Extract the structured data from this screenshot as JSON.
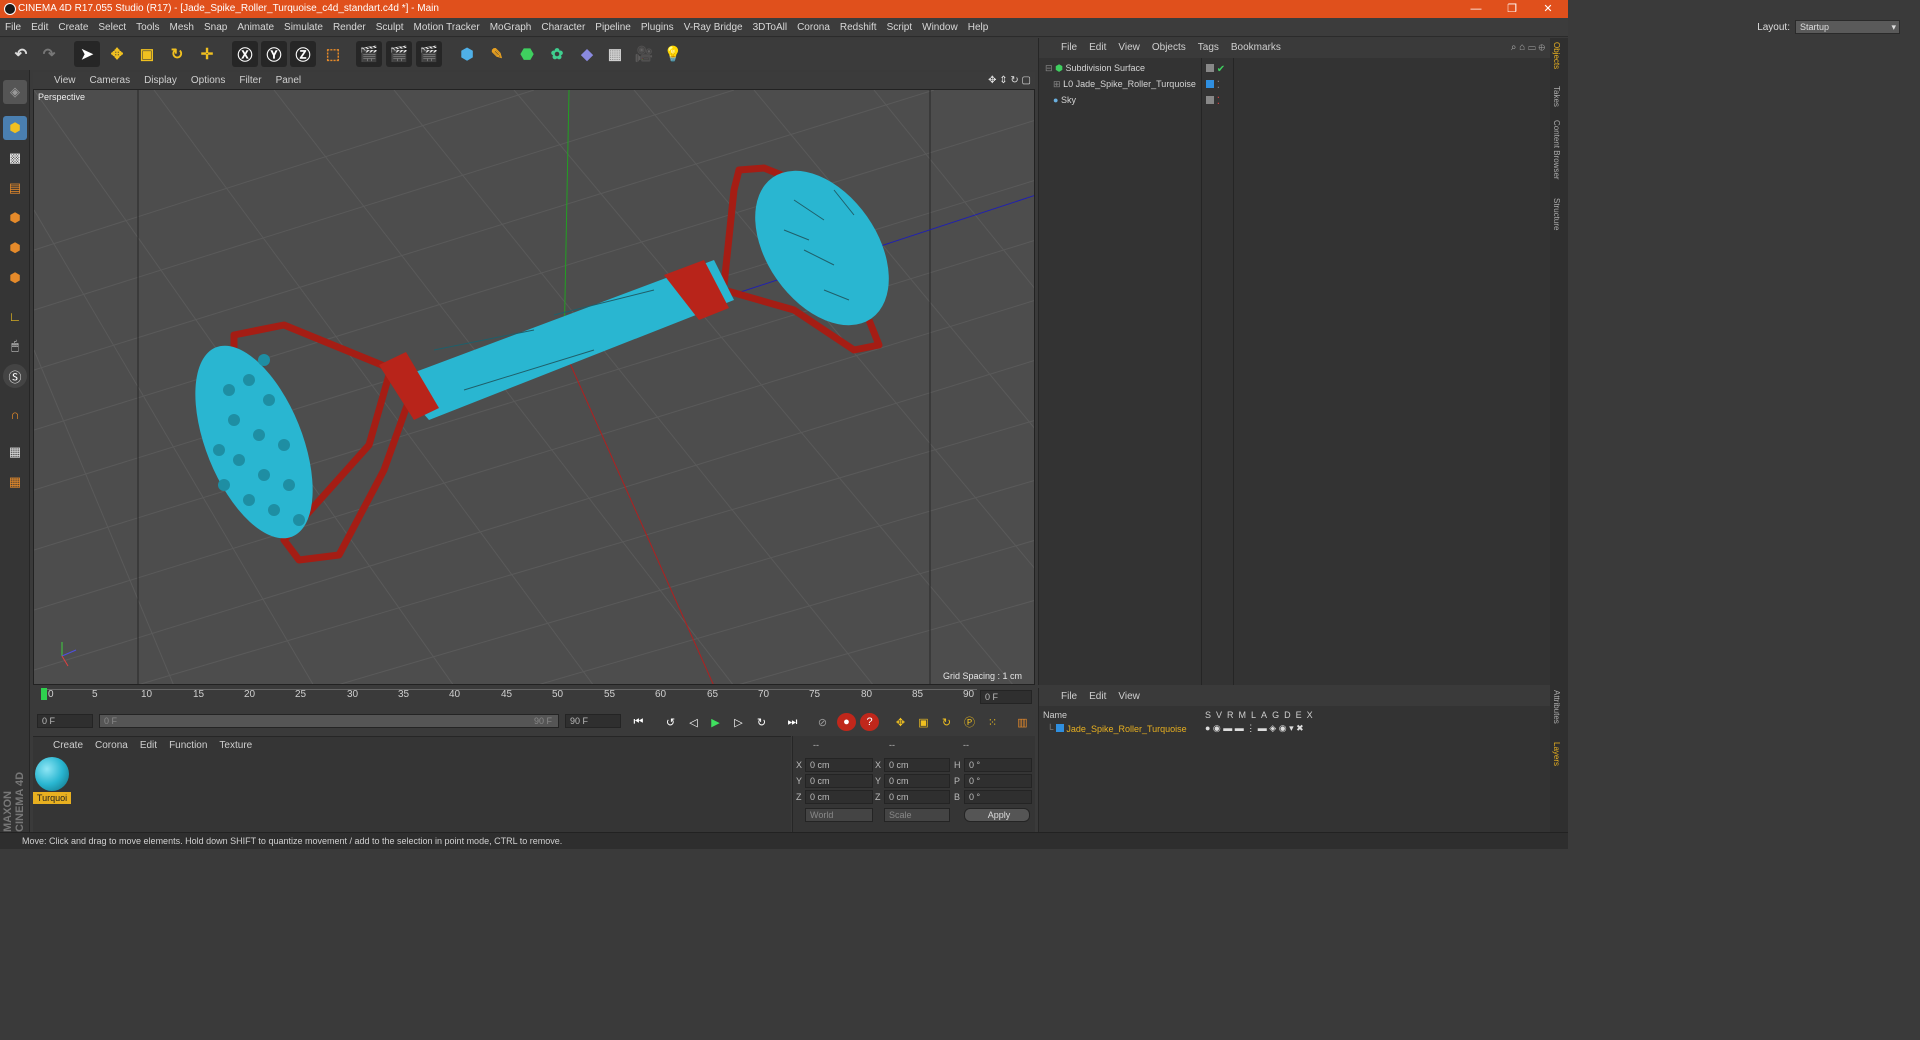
{
  "window": {
    "title": "CINEMA 4D R17.055 Studio (R17) - [Jade_Spike_Roller_Turquoise_c4d_standart.c4d *] - Main",
    "controls": [
      "—",
      "❐",
      "✕"
    ]
  },
  "menubar": {
    "items": [
      "File",
      "Edit",
      "Create",
      "Select",
      "Tools",
      "Mesh",
      "Snap",
      "Animate",
      "Simulate",
      "Render",
      "Sculpt",
      "Motion Tracker",
      "MoGraph",
      "Character",
      "Pipeline",
      "Plugins",
      "V-Ray Bridge",
      "3DToAll",
      "Corona",
      "Redshift",
      "Script",
      "Window",
      "Help"
    ],
    "layout_label": "Layout:",
    "layout_value": "Startup"
  },
  "viewport": {
    "menu": [
      "View",
      "Cameras",
      "Display",
      "Options",
      "Filter",
      "Panel"
    ],
    "label": "Perspective",
    "grid_info": "Grid Spacing : 1 cm",
    "colors": {
      "handle": "#c0271b",
      "roller": "#29b6d1",
      "background": "#4d4d4d"
    }
  },
  "timeline": {
    "ticks": [
      "0",
      "5",
      "10",
      "15",
      "20",
      "25",
      "30",
      "35",
      "40",
      "45",
      "50",
      "55",
      "60",
      "65",
      "70",
      "75",
      "80",
      "85",
      "90"
    ],
    "current_frame": "0 F",
    "start_field": "0 F",
    "range_start": "0 F",
    "range_end": "90 F",
    "end_field": "90 F"
  },
  "material_panel": {
    "menu": [
      "Create",
      "Corona",
      "Edit",
      "Function",
      "Texture"
    ],
    "material_name": "Turquoi"
  },
  "coords": {
    "headers": [
      "--",
      "--",
      "--"
    ],
    "rows": [
      {
        "a": "X",
        "av": "0 cm",
        "b": "X",
        "bv": "0 cm",
        "c": "H",
        "cv": "0 °"
      },
      {
        "a": "Y",
        "av": "0 cm",
        "b": "Y",
        "bv": "0 cm",
        "c": "P",
        "cv": "0 °"
      },
      {
        "a": "Z",
        "av": "0 cm",
        "b": "Z",
        "bv": "0 cm",
        "c": "B",
        "cv": "0 °"
      }
    ],
    "world": "World",
    "scale": "Scale",
    "apply": "Apply"
  },
  "objects": {
    "menu": [
      "File",
      "Edit",
      "View",
      "Objects",
      "Tags",
      "Bookmarks"
    ],
    "items": [
      {
        "name": "Subdivision Surface"
      },
      {
        "name": "Jade_Spike_Roller_Turquoise"
      },
      {
        "name": "Sky"
      }
    ]
  },
  "layers": {
    "menu": [
      "File",
      "Edit",
      "View"
    ],
    "name_header": "Name",
    "columns": [
      "S",
      "V",
      "R",
      "M",
      "L",
      "A",
      "G",
      "D",
      "E",
      "X"
    ],
    "row_name": "Jade_Spike_Roller_Turquoise"
  },
  "side_tabs": [
    "Objects",
    "Takes",
    "Content Browser",
    "Structure"
  ],
  "side_tabs_bottom": [
    "Attributes",
    "Layers"
  ],
  "brand": "MAXON CINEMA 4D",
  "status": "Move: Click and drag to move elements. Hold down SHIFT to quantize movement / add to the selection in point mode, CTRL to remove."
}
